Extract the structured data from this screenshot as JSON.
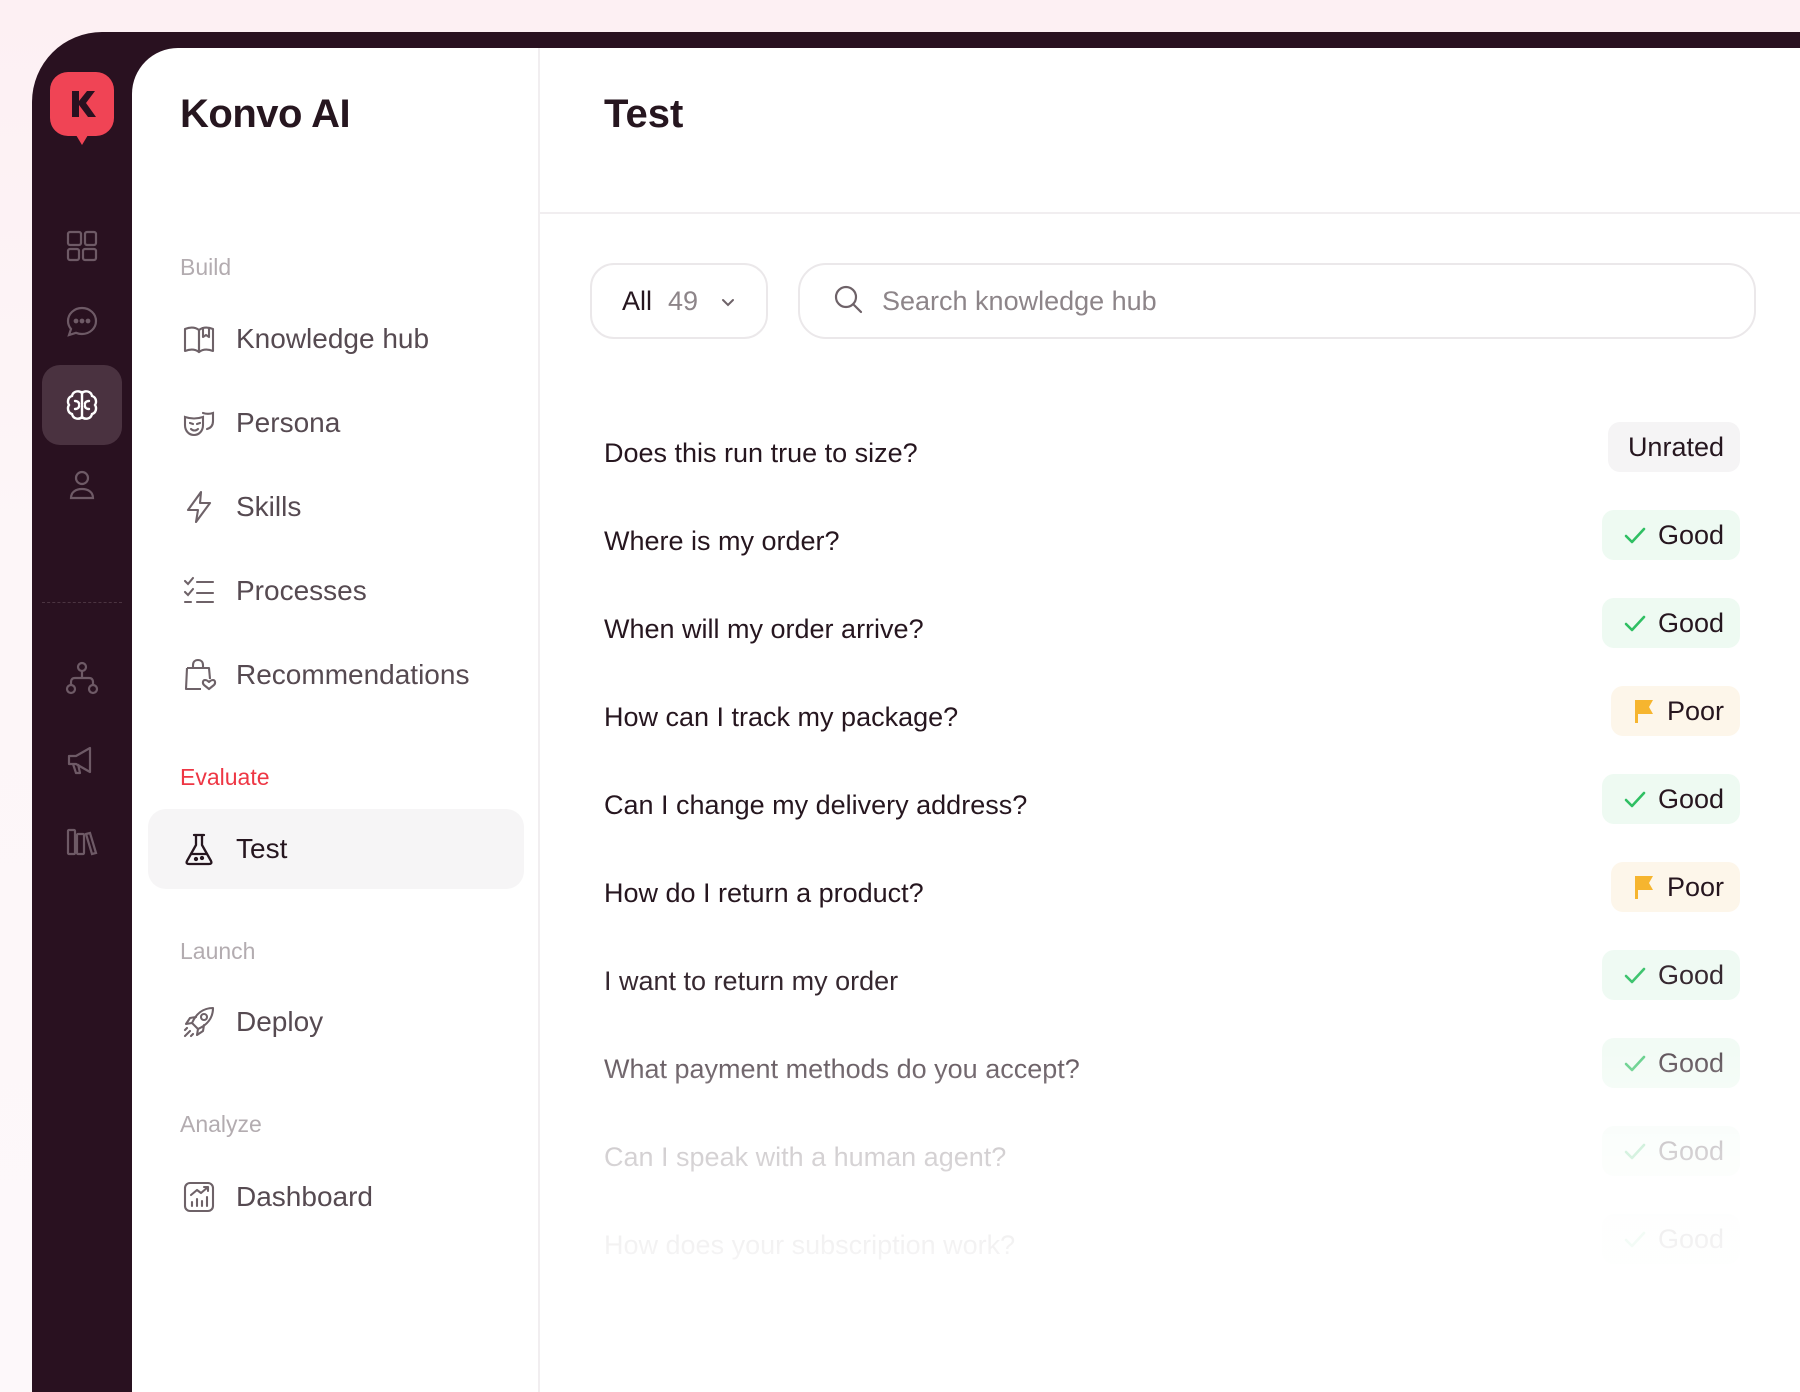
{
  "app": {
    "name": "Konvo AI"
  },
  "page": {
    "title": "Test"
  },
  "colors": {
    "brand": "#f04455",
    "rail": "#291120",
    "good": "#2fbf63",
    "poor": "#f6b52f"
  },
  "rail": {
    "items": [
      {
        "icon": "dashboard-grid-icon"
      },
      {
        "icon": "chat-bubble-icon"
      },
      {
        "icon": "brain-icon",
        "active": true
      },
      {
        "icon": "user-icon"
      },
      {
        "icon": "workflow-icon"
      },
      {
        "icon": "megaphone-icon"
      },
      {
        "icon": "library-icon"
      }
    ]
  },
  "nav": {
    "sections": [
      {
        "label": "Build",
        "items": [
          "Knowledge hub",
          "Persona",
          "Skills",
          "Processes",
          "Recommendations"
        ]
      },
      {
        "label": "Evaluate",
        "items": [
          "Test"
        ]
      },
      {
        "label": "Launch",
        "items": [
          "Deploy"
        ]
      },
      {
        "label": "Analyze",
        "items": [
          "Dashboard"
        ]
      }
    ]
  },
  "filter": {
    "label": "All",
    "count": "49"
  },
  "search": {
    "placeholder": "Search knowledge hub"
  },
  "tests": [
    {
      "question": "Does this run true to size?",
      "rating": "Unrated"
    },
    {
      "question": "Where is my order?",
      "rating": "Good"
    },
    {
      "question": "When will my order arrive?",
      "rating": "Good"
    },
    {
      "question": "How can I track my package?",
      "rating": "Poor"
    },
    {
      "question": "Can I change my delivery address?",
      "rating": "Good"
    },
    {
      "question": "How do I return a product?",
      "rating": "Poor"
    },
    {
      "question": "I want to return my order",
      "rating": "Good"
    },
    {
      "question": "What payment methods do you accept?",
      "rating": "Good"
    },
    {
      "question": "Can I speak with a human agent?",
      "rating": "Good"
    },
    {
      "question": "How does your subscription work?",
      "rating": "Good"
    }
  ]
}
